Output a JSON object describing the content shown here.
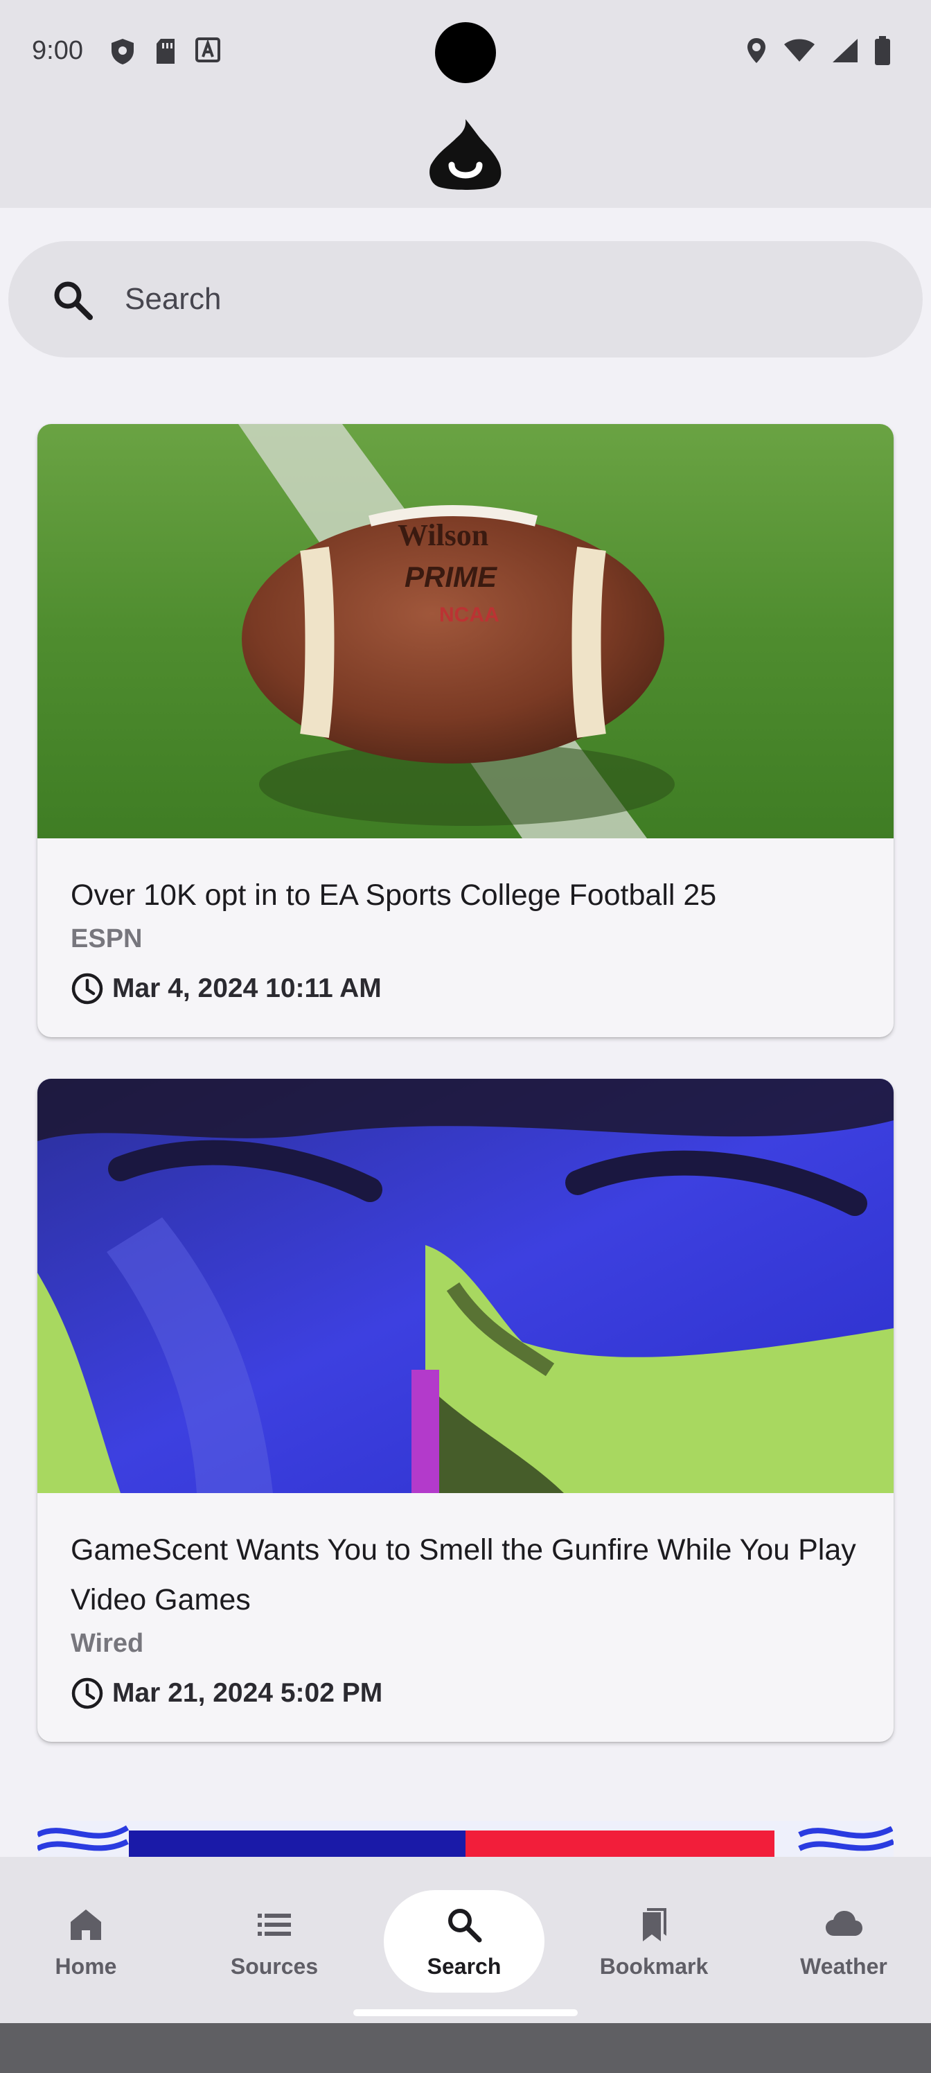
{
  "status_bar": {
    "time": "9:00",
    "left_icons": [
      "shield-icon",
      "sim-card-icon",
      "font-icon"
    ],
    "right_icons": [
      "location-icon",
      "wifi-icon",
      "signal-icon",
      "battery-icon"
    ]
  },
  "header": {
    "logo_icon": "feed-flame-logo-icon"
  },
  "search": {
    "placeholder": "Search",
    "value": ""
  },
  "articles": [
    {
      "title": "Over 10K opt in to EA Sports College Football 25",
      "source": "ESPN",
      "date": "Mar 4, 2024 10:11 AM",
      "image_description": "football on field"
    },
    {
      "title": "GameScent Wants You to Smell the Gunfire While You Play Video Games",
      "source": "Wired",
      "date": "Mar 21, 2024 5:02 PM",
      "image_description": "stylized face art"
    }
  ],
  "bottom_nav": {
    "active": "Search",
    "items": [
      {
        "label": "Home",
        "icon": "home-icon"
      },
      {
        "label": "Sources",
        "icon": "list-icon"
      },
      {
        "label": "Search",
        "icon": "search-icon"
      },
      {
        "label": "Bookmark",
        "icon": "bookmark-icon"
      },
      {
        "label": "Weather",
        "icon": "cloud-icon"
      }
    ]
  },
  "colors": {
    "background": "#f2f1f6",
    "surface_bar": "#e4e3e8",
    "active_pill": "#ffffff"
  }
}
